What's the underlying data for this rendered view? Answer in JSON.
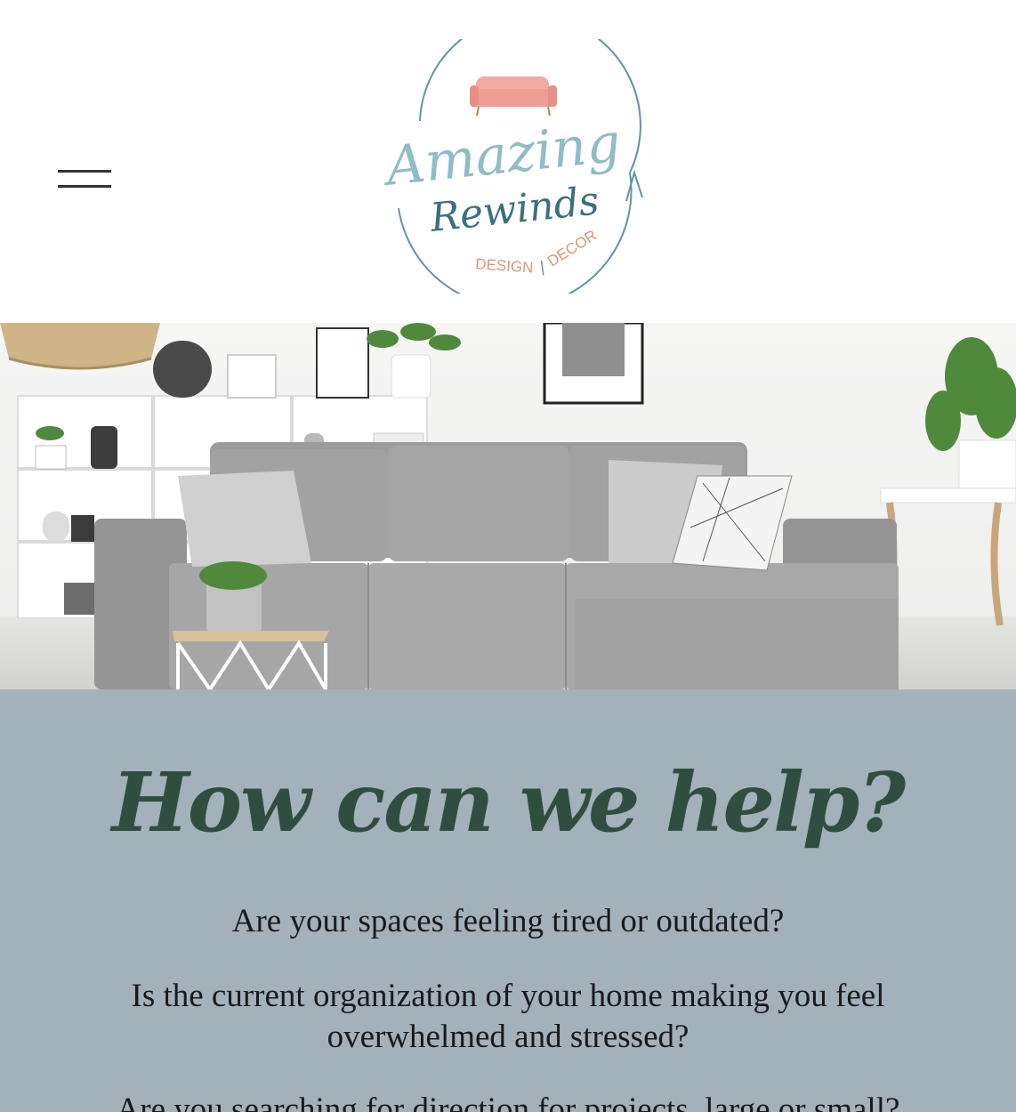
{
  "header": {
    "menu_icon": "hamburger-icon",
    "logo": {
      "line1": "Amazing",
      "line2": "Rewinds",
      "tagline_left": "DESIGN",
      "tagline_sep": "|",
      "tagline_right": "DECOR",
      "colors": {
        "ring": "#5f95a6",
        "script_light": "#8fbcc6",
        "script_dark": "#3b6f82",
        "tagline": "#d9967a",
        "sofa": "#f0a8a0"
      }
    }
  },
  "hero": {
    "subject": "grey sofa in bright living room"
  },
  "help": {
    "title": "How can we help?",
    "questions": [
      "Are your spaces feeling tired or outdated?",
      "Is the current organization of your home making you feel overwhelmed and stressed?",
      "Are you searching for direction for projects, large or small?"
    ],
    "colors": {
      "background": "#a3b1bb",
      "title": "#2f4e3f"
    }
  }
}
